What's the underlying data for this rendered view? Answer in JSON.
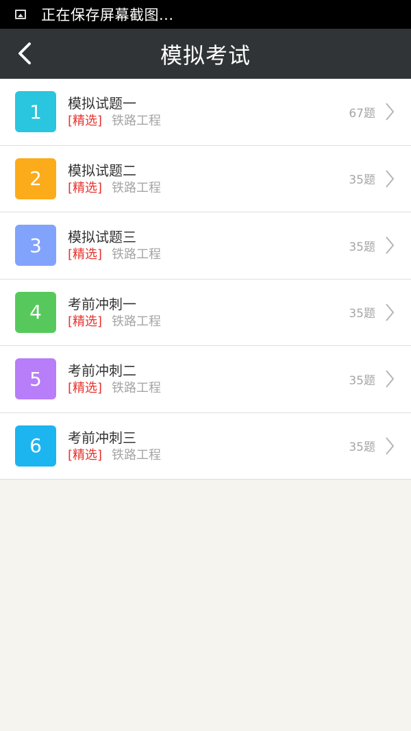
{
  "status_bar": {
    "icon": "image-icon",
    "text": "正在保存屏幕截图..."
  },
  "header": {
    "title": "模拟考试",
    "back_icon": "chevron-left-icon"
  },
  "items": [
    {
      "number": "1",
      "title": "模拟试题一",
      "tag": "[精选]",
      "category": "铁路工程",
      "count": "67题",
      "color": "#2ac5de"
    },
    {
      "number": "2",
      "title": "模拟试题二",
      "tag": "[精选]",
      "category": "铁路工程",
      "count": "35题",
      "color": "#fcab1a"
    },
    {
      "number": "3",
      "title": "模拟试题三",
      "tag": "[精选]",
      "category": "铁路工程",
      "count": "35题",
      "color": "#82a3fb"
    },
    {
      "number": "4",
      "title": "考前冲刺一",
      "tag": "[精选]",
      "category": "铁路工程",
      "count": "35题",
      "color": "#57c95c"
    },
    {
      "number": "5",
      "title": "考前冲刺二",
      "tag": "[精选]",
      "category": "铁路工程",
      "count": "35题",
      "color": "#b87df8"
    },
    {
      "number": "6",
      "title": "考前冲刺三",
      "tag": "[精选]",
      "category": "铁路工程",
      "count": "35题",
      "color": "#1db5ef"
    }
  ],
  "colors": {
    "header_bg": "#303437",
    "tag": "#e6322d",
    "muted": "#a5a5a5",
    "page_bg": "#f6f4ef"
  }
}
